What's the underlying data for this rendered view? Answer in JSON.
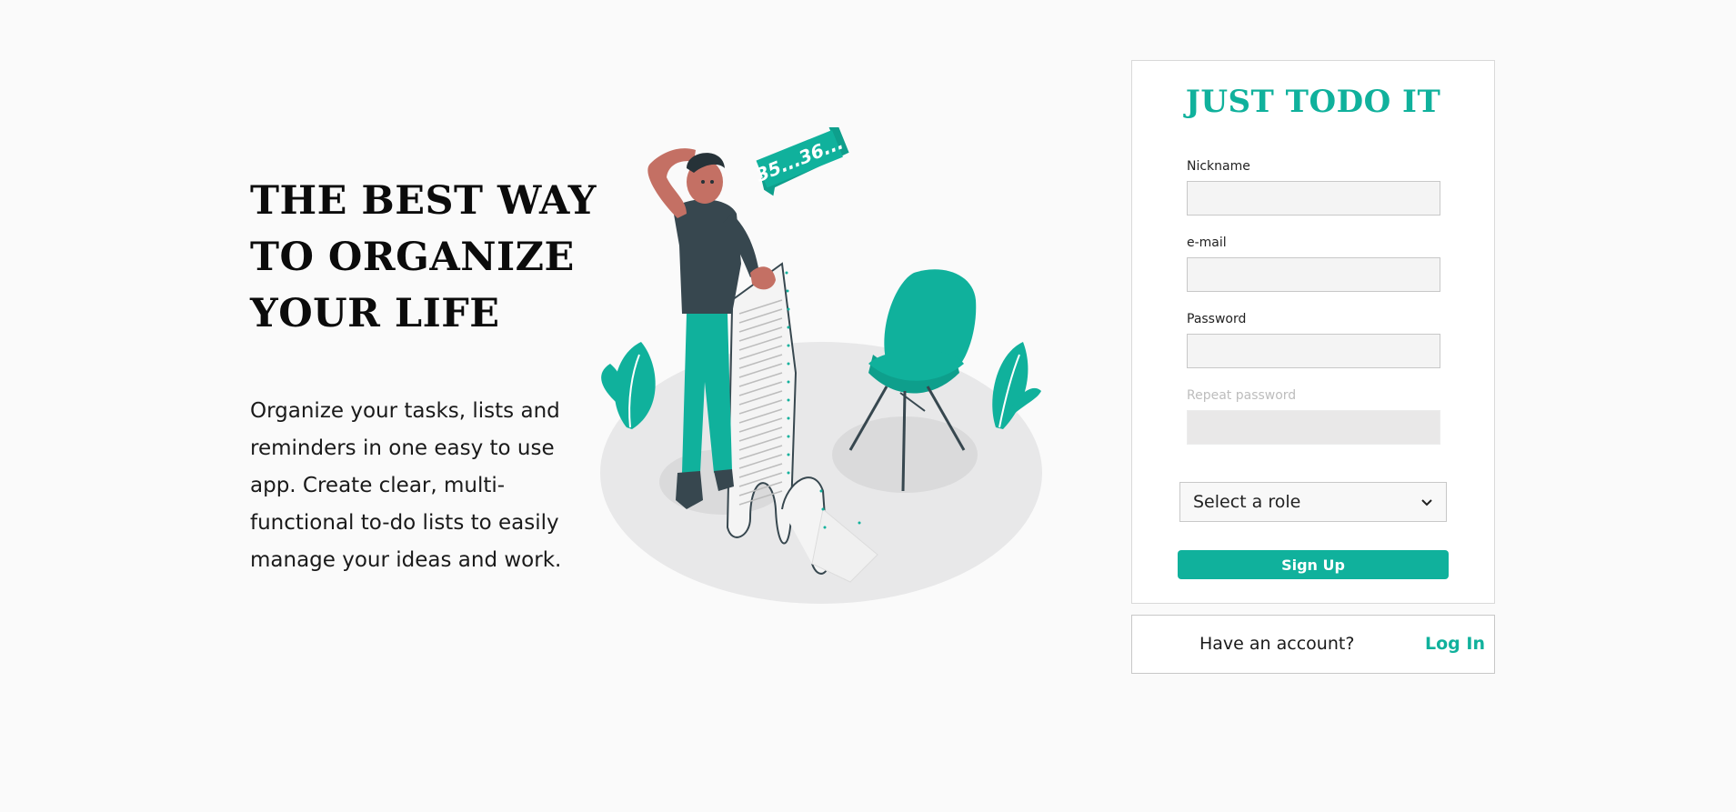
{
  "hero": {
    "title_lines": [
      "THE BEST WAY",
      "TO ORGANIZE",
      "YOUR LIFE"
    ],
    "description": "Organize your tasks, lists and reminders in one easy to use app. Create clear, multi-functional to-do lists to easily manage your ideas and work."
  },
  "illustration": {
    "bubble_text": "35...36..."
  },
  "signup": {
    "brand": "JUST TODO IT",
    "fields": [
      {
        "label": "Nickname",
        "value": "",
        "disabled": false
      },
      {
        "label": "e-mail",
        "value": "",
        "disabled": false
      },
      {
        "label": "Password",
        "value": "",
        "disabled": false
      },
      {
        "label": "Repeat password",
        "value": "",
        "disabled": true
      }
    ],
    "role_select": {
      "selected": "Select a role"
    },
    "button_label": "Sign Up"
  },
  "login": {
    "prompt": "Have an account?",
    "link_label": "Log In"
  },
  "colors": {
    "accent": "#10b19c",
    "background": "#fafafa"
  }
}
